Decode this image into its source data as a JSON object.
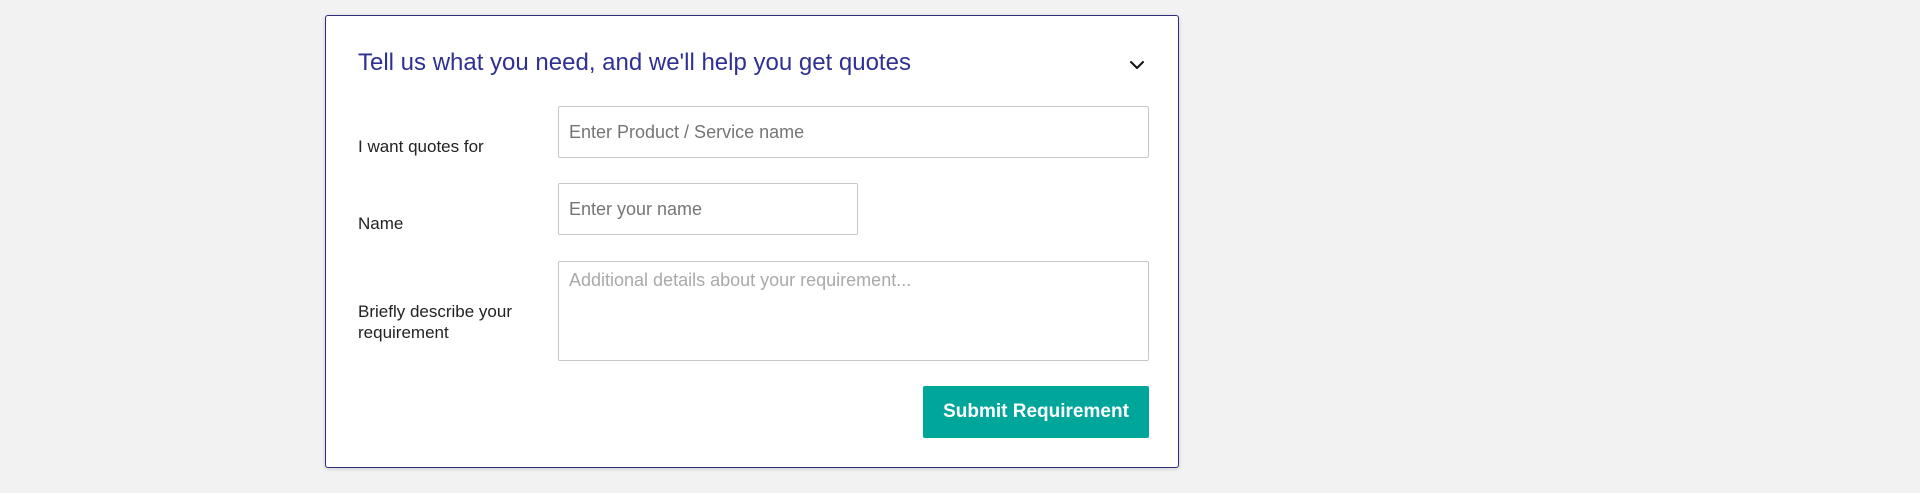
{
  "form": {
    "title": "Tell us what you need, and we'll help you get quotes",
    "collapse_icon": "chevron-down-icon",
    "fields": {
      "product": {
        "label": "I want quotes for",
        "value": "",
        "placeholder": "Enter Product / Service name"
      },
      "name": {
        "label": "Name",
        "value": "",
        "placeholder": "Enter your name"
      },
      "requirement": {
        "label": "Briefly describe your requirement",
        "value": "",
        "placeholder": "Additional details about your requirement..."
      }
    },
    "submit_label": "Submit Requirement"
  },
  "colors": {
    "title": "#2e3192",
    "card_border": "#2e2e7f",
    "submit_bg": "#00a699",
    "page_bg": "#f2f2f2"
  }
}
